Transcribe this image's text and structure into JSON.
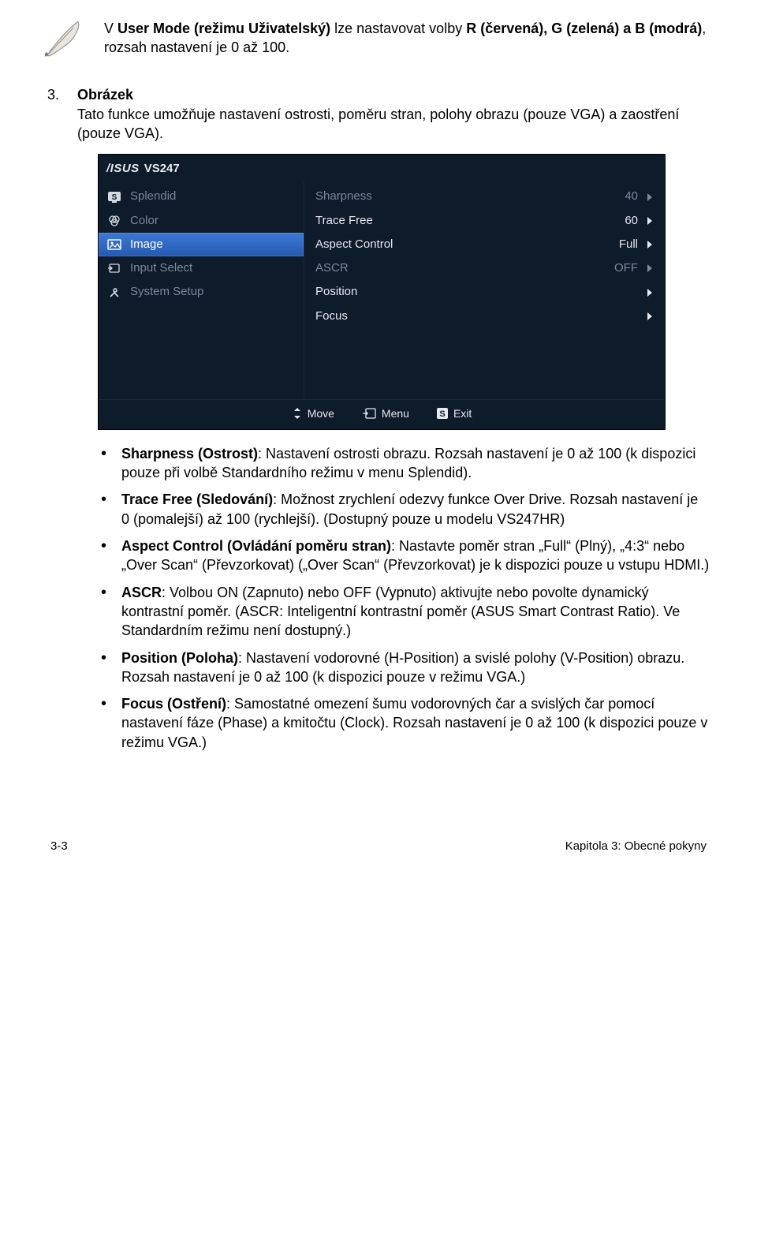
{
  "note": {
    "prefix": "V ",
    "bold1": "User Mode (režimu Uživatelský)",
    "mid": " lze nastavovat volby ",
    "bold2": "R (červená), G (zelená) a B (modrá)",
    "suffix": ", rozsah nastavení je 0 až 100."
  },
  "section": {
    "num": "3.",
    "title": "Obrázek",
    "text": "Tato funkce umožňuje nastavení ostrosti, poměru stran, polohy obrazu (pouze VGA) a zaostření (pouze VGA)."
  },
  "osd": {
    "model": "VS247",
    "menu": [
      {
        "label": "Splendid",
        "icon": "s-box"
      },
      {
        "label": "Color",
        "icon": "rgb"
      },
      {
        "label": "Image",
        "icon": "image",
        "selected": true
      },
      {
        "label": "Input Select",
        "icon": "input"
      },
      {
        "label": "System Setup",
        "icon": "tools"
      }
    ],
    "settings": [
      {
        "label": "Sharpness",
        "value": "40",
        "dim": true
      },
      {
        "label": "Trace Free",
        "value": "60"
      },
      {
        "label": "Aspect Control",
        "value": "Full"
      },
      {
        "label": "ASCR",
        "value": "OFF",
        "dim": true
      },
      {
        "label": "Position",
        "value": ""
      },
      {
        "label": "Focus",
        "value": ""
      }
    ],
    "footer": {
      "move": "Move",
      "menu": "Menu",
      "exit": "Exit"
    }
  },
  "bullets": [
    {
      "bold": "Sharpness (Ostrost)",
      "text": ": Nastavení ostrosti obrazu. Rozsah nastavení je 0 až 100 (k dispozici pouze při volbě Standardního režimu v menu Splendid)."
    },
    {
      "bold": "Trace Free (Sledování)",
      "text": ": Možnost zrychlení odezvy funkce Over Drive. Rozsah nastavení je 0 (pomalejší) až 100 (rychlejší). (Dostupný pouze u modelu VS247HR)"
    },
    {
      "bold": "Aspect Control (Ovládání poměru stran)",
      "text": ": Nastavte poměr stran „Full“ (Plný), „4:3“ nebo „Over Scan“ (Převzorkovat) („Over Scan“ (Převzorkovat) je k dispozici pouze u vstupu HDMI.)"
    },
    {
      "bold": "ASCR",
      "text": ": Volbou ON (Zapnuto) nebo OFF (Vypnuto) aktivujte nebo povolte dynamický kontrastní poměr. (ASCR: Inteligentní kontrastní poměr (ASUS Smart Contrast Ratio). Ve Standardním režimu není dostupný.)"
    },
    {
      "bold": "Position (Poloha)",
      "text": ": Nastavení vodorovné (H-Position) a svislé polohy (V-Position) obrazu. Rozsah nastavení je 0 až 100 (k dispozici pouze v režimu VGA.)"
    },
    {
      "bold": "Focus (Ostření)",
      "text": ": Samostatné omezení šumu vodorovných čar a svislých čar pomocí nastavení fáze (Phase) a kmitočtu (Clock). Rozsah nastavení je 0 až 100 (k dispozici pouze v režimu VGA.)"
    }
  ],
  "footer": {
    "left": "3-3",
    "right": "Kapitola 3: Obecné pokyny"
  }
}
